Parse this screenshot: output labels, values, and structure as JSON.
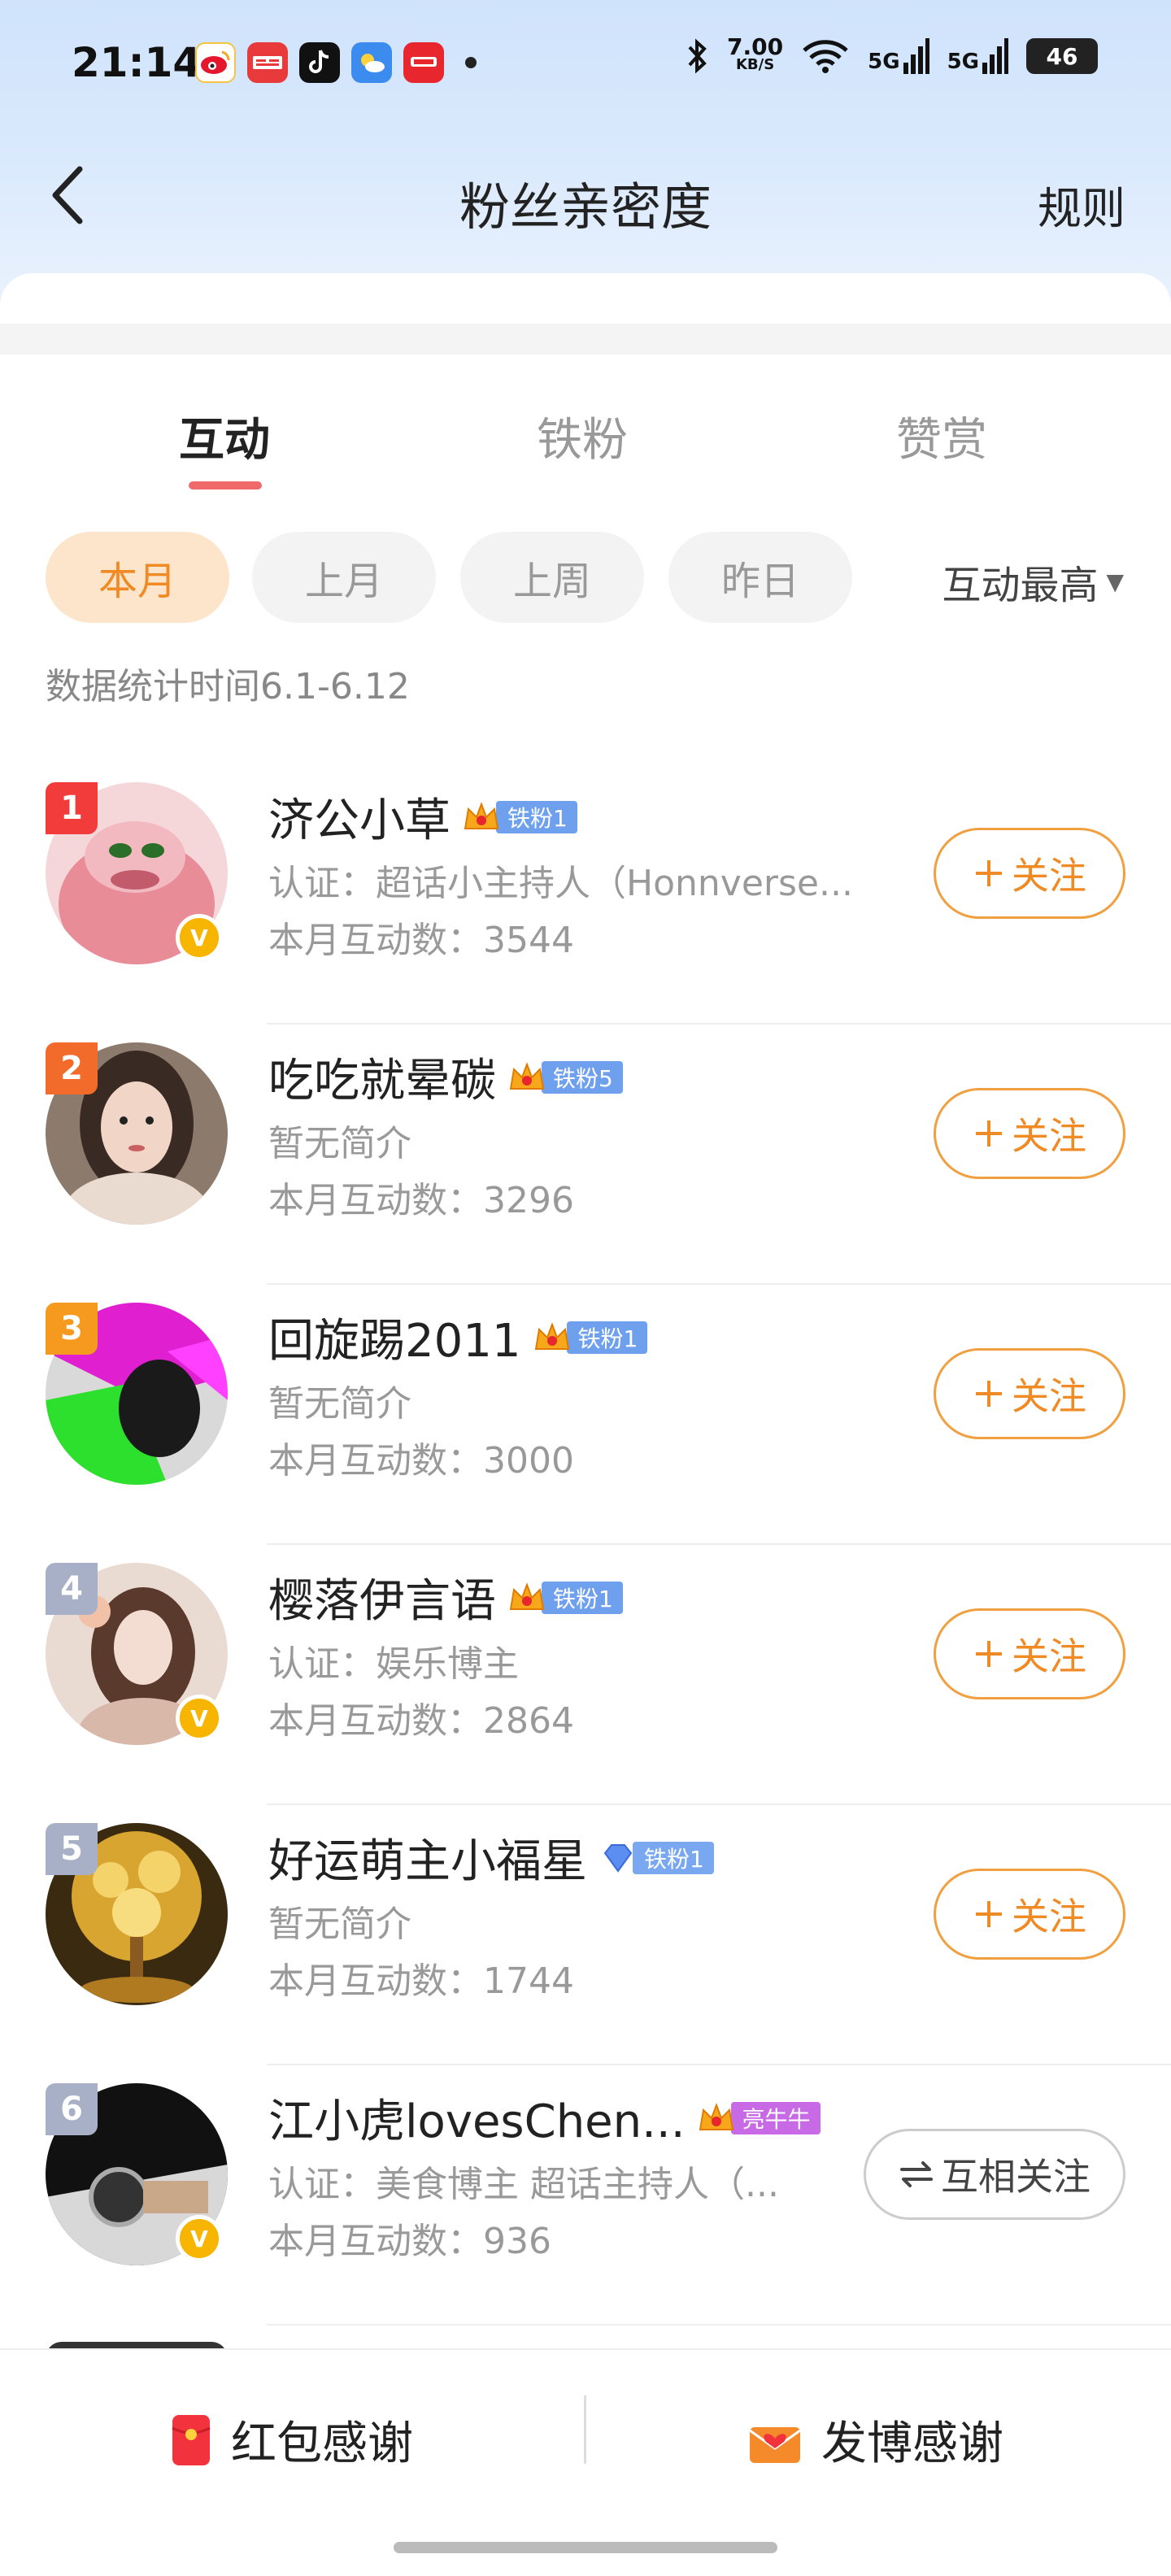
{
  "status_bar": {
    "time": "21:14",
    "net_speed": "7.00",
    "net_unit": "KB/S",
    "signal1": "5G",
    "signal2": "5G",
    "battery": "46"
  },
  "nav": {
    "title": "粉丝亲密度",
    "rule_label": "规则"
  },
  "tabs": [
    {
      "label": "互动",
      "active": true
    },
    {
      "label": "铁粉",
      "active": false
    },
    {
      "label": "赞赏",
      "active": false
    }
  ],
  "filters": {
    "chips": [
      "本月",
      "上月",
      "上周",
      "昨日"
    ],
    "selected": "本月",
    "sort_label": "互动最高"
  },
  "stat_time": "数据统计时间6.1-6.12",
  "fans": [
    {
      "rank": "1",
      "name": "济公小草",
      "badge": "铁粉1",
      "badge_type": "blue",
      "desc": "认证：超话小主持人（Honnverse...",
      "count": "本月互动数：3544",
      "verified": true,
      "action": "关注",
      "rank_color": "#f23b3b"
    },
    {
      "rank": "2",
      "name": "吃吃就晕碳",
      "badge": "铁粉5",
      "badge_type": "blue",
      "desc": "暂无简介",
      "count": "本月互动数：3296",
      "verified": false,
      "action": "关注",
      "rank_color": "#f26b2b"
    },
    {
      "rank": "3",
      "name": "回旋踢2011",
      "badge": "铁粉1",
      "badge_type": "blue",
      "desc": "暂无简介",
      "count": "本月互动数：3000",
      "verified": false,
      "action": "关注",
      "rank_color": "#f59a1e"
    },
    {
      "rank": "4",
      "name": "樱落伊言语",
      "badge": "铁粉1",
      "badge_type": "blue",
      "desc": "认证：娱乐博主",
      "count": "本月互动数：2864",
      "verified": true,
      "action": "关注",
      "rank_color": "#a8b0c8"
    },
    {
      "rank": "5",
      "name": "好运萌主小福星",
      "badge": "铁粉1",
      "badge_type": "diamond",
      "desc": "暂无简介",
      "count": "本月互动数：1744",
      "verified": false,
      "action": "关注",
      "rank_color": "#a8b0c8"
    },
    {
      "rank": "6",
      "name": "江小虎lovesChen...",
      "badge": "亮牛牛",
      "badge_type": "purple",
      "desc": "认证：美食博主 超话主持人（...",
      "count": "本月互动数：936",
      "verified": true,
      "action": "互相关注",
      "rank_color": "#a8b0c8"
    }
  ],
  "bottom": {
    "red_packet_label": "红包感谢",
    "post_label": "发博感谢"
  }
}
